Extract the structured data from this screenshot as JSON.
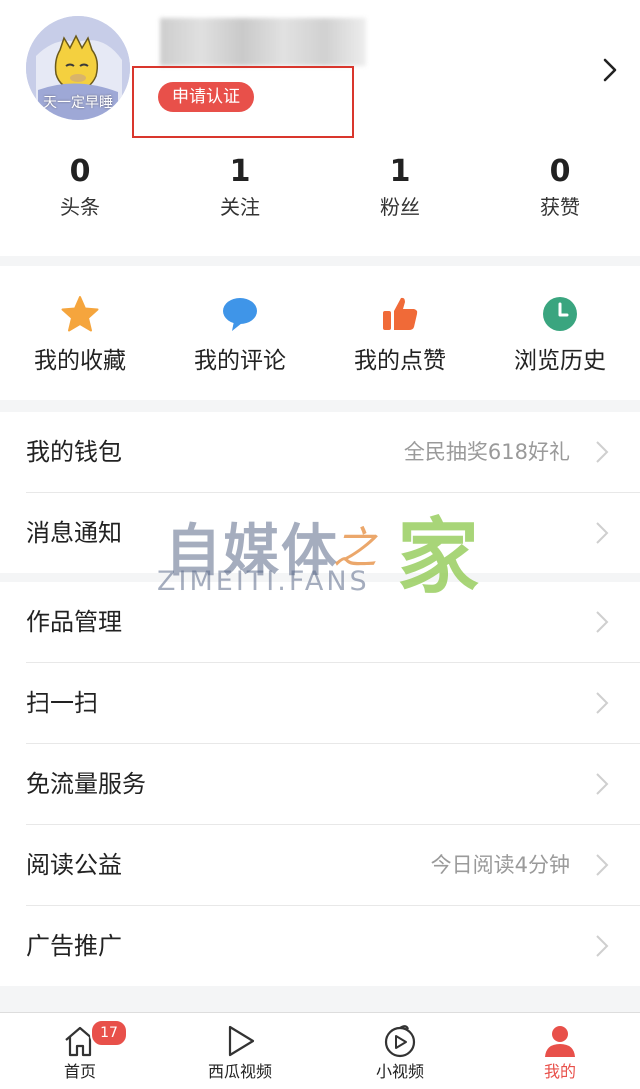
{
  "profile": {
    "avatar_caption": "天一定早睡",
    "cert_badge": "申请认证",
    "stats": [
      {
        "value": "0",
        "label": "头条"
      },
      {
        "value": "1",
        "label": "关注"
      },
      {
        "value": "1",
        "label": "粉丝"
      },
      {
        "value": "0",
        "label": "获赞"
      }
    ]
  },
  "quick_actions": [
    {
      "label": "我的收藏",
      "icon": "star-icon",
      "color": "#f5a53d"
    },
    {
      "label": "我的评论",
      "icon": "comment-icon",
      "color": "#3f95e8"
    },
    {
      "label": "我的点赞",
      "icon": "thumbs-up-icon",
      "color": "#f06a38"
    },
    {
      "label": "浏览历史",
      "icon": "clock-icon",
      "color": "#3aa57f"
    }
  ],
  "menu_group_1": [
    {
      "label": "我的钱包",
      "extra": "全民抽奖618好礼"
    },
    {
      "label": "消息通知",
      "extra": ""
    }
  ],
  "menu_group_2": [
    {
      "label": "作品管理",
      "extra": ""
    },
    {
      "label": "扫一扫",
      "extra": ""
    },
    {
      "label": "免流量服务",
      "extra": ""
    },
    {
      "label": "阅读公益",
      "extra": "今日阅读4分钟"
    },
    {
      "label": "广告推广",
      "extra": ""
    }
  ],
  "watermark": {
    "zh_main": "自媒体",
    "zh_zhi": "之",
    "zh_jia": "家",
    "en": "ZIMEITI.FANS"
  },
  "tabbar": [
    {
      "label": "首页",
      "icon": "home-icon",
      "badge": "17"
    },
    {
      "label": "西瓜视频",
      "icon": "play-icon",
      "badge": ""
    },
    {
      "label": "小视频",
      "icon": "short-video-icon",
      "badge": ""
    },
    {
      "label": "我的",
      "icon": "profile-icon",
      "badge": "",
      "active": true
    }
  ],
  "colors": {
    "accent": "#e8504a",
    "muted": "#9a9a9a"
  }
}
